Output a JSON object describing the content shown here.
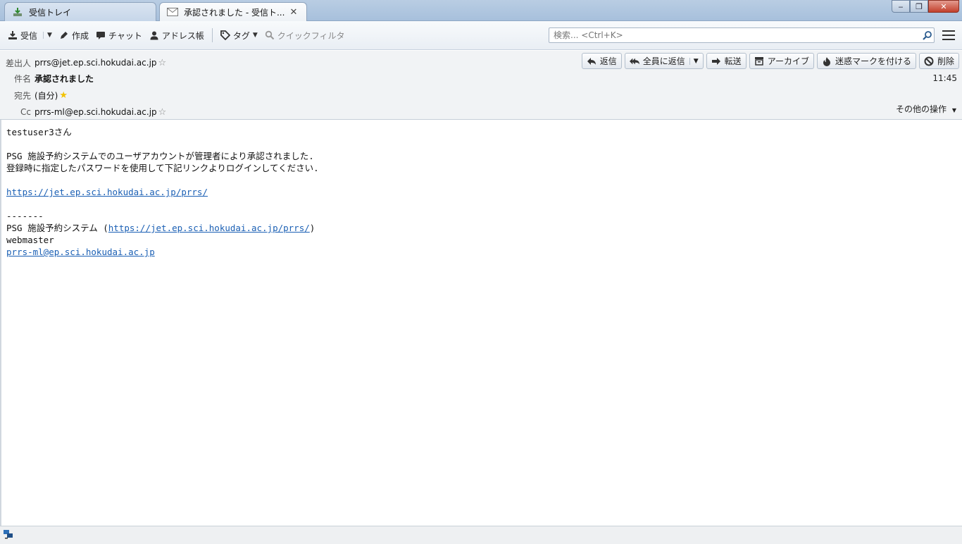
{
  "tabs": [
    {
      "label": "受信トレイ",
      "icon": "inbox-download-icon"
    },
    {
      "label": "承認されました - 受信ト...",
      "icon": "envelope-icon",
      "close": "✕"
    }
  ],
  "window": {
    "minimize": "‒",
    "restore": "❐",
    "close": "✕"
  },
  "toolbar": {
    "receive": "受信",
    "compose": "作成",
    "chat": "チャット",
    "address_book": "アドレス帳",
    "tag": "タグ",
    "quick_filter": "クイックフィルタ",
    "search_placeholder": "検索... <Ctrl+K>"
  },
  "header": {
    "from_label": "差出人",
    "from_value": "prrs@jet.ep.sci.hokudai.ac.jp",
    "subject_label": "件名",
    "subject_value": "承認されました",
    "to_label": "宛先",
    "to_value": "(自分)",
    "cc_label": "Cc",
    "cc_value": "prrs-ml@ep.sci.hokudai.ac.jp",
    "time": "11:45",
    "more_actions": "その他の操作",
    "actions": {
      "reply": "返信",
      "reply_all": "全員に返信",
      "forward": "転送",
      "archive": "アーカイブ",
      "junk": "迷惑マークを付ける",
      "delete": "削除"
    }
  },
  "body": {
    "line1": "testuser3さん",
    "line2": "PSG 施設予約システムでのユーザアカウントが管理者により承認されました.",
    "line3": "登録時に指定したパスワードを使用して下記リンクよりログインしてください.",
    "link1": "https://jet.ep.sci.hokudai.ac.jp/prrs/",
    "separator": "-------",
    "sig_prefix": "PSG 施設予約システム (",
    "sig_link": "https://jet.ep.sci.hokudai.ac.jp/prrs/",
    "sig_suffix": ")",
    "sig_name": "webmaster",
    "sig_email": "prrs-ml@ep.sci.hokudai.ac.jp"
  },
  "colors": {
    "link": "#1a5fb4",
    "star_filled": "#f2c200"
  }
}
